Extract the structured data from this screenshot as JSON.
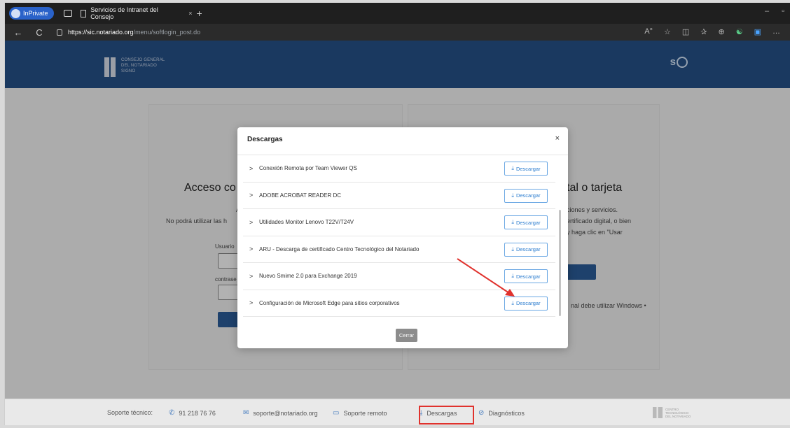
{
  "browser": {
    "inprivate_label": "InPrivate",
    "tab_title": "Servicios de Intranet del Consejo",
    "tab_close": "×",
    "new_tab": "+",
    "url_host": "https://sic.notariado.org",
    "url_path": "/menu/softlogin_post.do",
    "back": "←",
    "reload": "C",
    "win_min": "–",
    "win_max": "▫",
    "toolbar_icons": [
      "A°",
      "☆",
      "◫",
      "✰",
      "⊕",
      "☯",
      "▣",
      "…"
    ]
  },
  "site": {
    "logo_text_1": "CONSEJO GENERAL",
    "logo_text_2": "DEL NOTARIADO",
    "logo_text_3": "SIGNO",
    "sic_text": "s"
  },
  "left_card": {
    "title": "Acceso co",
    "line1": "A",
    "line2": "No podrá utilizar las h",
    "usuario_label": "Usuario",
    "contrasena_label": "contrase"
  },
  "right_card": {
    "title": "tal o tarjeta",
    "line1": "ciones y servicios.",
    "line2": "ertificado digital, o bien",
    "line3": "y haga clic en \"Usar",
    "footnote": "nal debe utilizar Windows •"
  },
  "modal": {
    "title": "Descargas",
    "close": "×",
    "items": [
      {
        "label": "Conexión Remota por Team Viewer QS",
        "button": "Descargar"
      },
      {
        "label": "ADOBE ACROBAT READER DC",
        "button": "Descargar"
      },
      {
        "label": "Utilidades Monitor Lenovo T22V/T24V",
        "button": "Descargar"
      },
      {
        "label": "ARU - Descarga de certificado Centro Tecnológico del Notariado",
        "button": "Descargar"
      },
      {
        "label": "Nuevo Smime 2.0 para Exchange 2019",
        "button": "Descargar"
      },
      {
        "label": "Configuración de Microsoft Edge para sitios corporativos",
        "button": "Descargar"
      }
    ],
    "cerrar": "Cerrar"
  },
  "footer": {
    "soporte_label": "Soporte técnico:",
    "phone": "91 218 76 76",
    "email": "soporte@notariado.org",
    "remote": "Soporte remoto",
    "descargas": "Descargas",
    "diagnosticos": "Diagnósticos",
    "cto_1": "CENTRO",
    "cto_2": "TECNOLÓGICO",
    "cto_3": "DEL NOTARIADO"
  },
  "colors": {
    "header_blue": "#244f86",
    "download_blue": "#2f7fd0",
    "highlight_red": "#e0322d"
  }
}
